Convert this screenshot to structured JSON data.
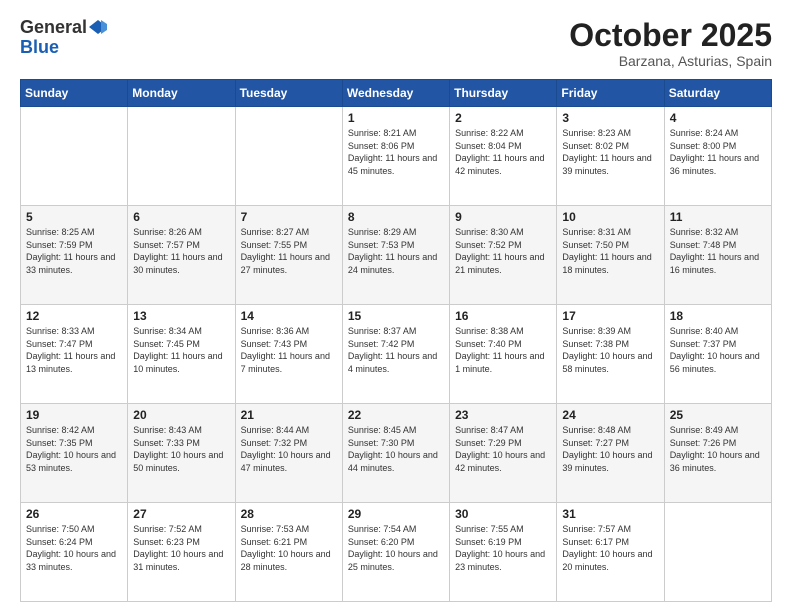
{
  "header": {
    "logo_general": "General",
    "logo_blue": "Blue",
    "month": "October 2025",
    "location": "Barzana, Asturias, Spain"
  },
  "weekdays": [
    "Sunday",
    "Monday",
    "Tuesday",
    "Wednesday",
    "Thursday",
    "Friday",
    "Saturday"
  ],
  "weeks": [
    [
      {
        "day": "",
        "sunrise": "",
        "sunset": "",
        "daylight": ""
      },
      {
        "day": "",
        "sunrise": "",
        "sunset": "",
        "daylight": ""
      },
      {
        "day": "",
        "sunrise": "",
        "sunset": "",
        "daylight": ""
      },
      {
        "day": "1",
        "sunrise": "8:21 AM",
        "sunset": "8:06 PM",
        "daylight": "11 hours and 45 minutes."
      },
      {
        "day": "2",
        "sunrise": "8:22 AM",
        "sunset": "8:04 PM",
        "daylight": "11 hours and 42 minutes."
      },
      {
        "day": "3",
        "sunrise": "8:23 AM",
        "sunset": "8:02 PM",
        "daylight": "11 hours and 39 minutes."
      },
      {
        "day": "4",
        "sunrise": "8:24 AM",
        "sunset": "8:00 PM",
        "daylight": "11 hours and 36 minutes."
      }
    ],
    [
      {
        "day": "5",
        "sunrise": "8:25 AM",
        "sunset": "7:59 PM",
        "daylight": "11 hours and 33 minutes."
      },
      {
        "day": "6",
        "sunrise": "8:26 AM",
        "sunset": "7:57 PM",
        "daylight": "11 hours and 30 minutes."
      },
      {
        "day": "7",
        "sunrise": "8:27 AM",
        "sunset": "7:55 PM",
        "daylight": "11 hours and 27 minutes."
      },
      {
        "day": "8",
        "sunrise": "8:29 AM",
        "sunset": "7:53 PM",
        "daylight": "11 hours and 24 minutes."
      },
      {
        "day": "9",
        "sunrise": "8:30 AM",
        "sunset": "7:52 PM",
        "daylight": "11 hours and 21 minutes."
      },
      {
        "day": "10",
        "sunrise": "8:31 AM",
        "sunset": "7:50 PM",
        "daylight": "11 hours and 18 minutes."
      },
      {
        "day": "11",
        "sunrise": "8:32 AM",
        "sunset": "7:48 PM",
        "daylight": "11 hours and 16 minutes."
      }
    ],
    [
      {
        "day": "12",
        "sunrise": "8:33 AM",
        "sunset": "7:47 PM",
        "daylight": "11 hours and 13 minutes."
      },
      {
        "day": "13",
        "sunrise": "8:34 AM",
        "sunset": "7:45 PM",
        "daylight": "11 hours and 10 minutes."
      },
      {
        "day": "14",
        "sunrise": "8:36 AM",
        "sunset": "7:43 PM",
        "daylight": "11 hours and 7 minutes."
      },
      {
        "day": "15",
        "sunrise": "8:37 AM",
        "sunset": "7:42 PM",
        "daylight": "11 hours and 4 minutes."
      },
      {
        "day": "16",
        "sunrise": "8:38 AM",
        "sunset": "7:40 PM",
        "daylight": "11 hours and 1 minute."
      },
      {
        "day": "17",
        "sunrise": "8:39 AM",
        "sunset": "7:38 PM",
        "daylight": "10 hours and 58 minutes."
      },
      {
        "day": "18",
        "sunrise": "8:40 AM",
        "sunset": "7:37 PM",
        "daylight": "10 hours and 56 minutes."
      }
    ],
    [
      {
        "day": "19",
        "sunrise": "8:42 AM",
        "sunset": "7:35 PM",
        "daylight": "10 hours and 53 minutes."
      },
      {
        "day": "20",
        "sunrise": "8:43 AM",
        "sunset": "7:33 PM",
        "daylight": "10 hours and 50 minutes."
      },
      {
        "day": "21",
        "sunrise": "8:44 AM",
        "sunset": "7:32 PM",
        "daylight": "10 hours and 47 minutes."
      },
      {
        "day": "22",
        "sunrise": "8:45 AM",
        "sunset": "7:30 PM",
        "daylight": "10 hours and 44 minutes."
      },
      {
        "day": "23",
        "sunrise": "8:47 AM",
        "sunset": "7:29 PM",
        "daylight": "10 hours and 42 minutes."
      },
      {
        "day": "24",
        "sunrise": "8:48 AM",
        "sunset": "7:27 PM",
        "daylight": "10 hours and 39 minutes."
      },
      {
        "day": "25",
        "sunrise": "8:49 AM",
        "sunset": "7:26 PM",
        "daylight": "10 hours and 36 minutes."
      }
    ],
    [
      {
        "day": "26",
        "sunrise": "7:50 AM",
        "sunset": "6:24 PM",
        "daylight": "10 hours and 33 minutes."
      },
      {
        "day": "27",
        "sunrise": "7:52 AM",
        "sunset": "6:23 PM",
        "daylight": "10 hours and 31 minutes."
      },
      {
        "day": "28",
        "sunrise": "7:53 AM",
        "sunset": "6:21 PM",
        "daylight": "10 hours and 28 minutes."
      },
      {
        "day": "29",
        "sunrise": "7:54 AM",
        "sunset": "6:20 PM",
        "daylight": "10 hours and 25 minutes."
      },
      {
        "day": "30",
        "sunrise": "7:55 AM",
        "sunset": "6:19 PM",
        "daylight": "10 hours and 23 minutes."
      },
      {
        "day": "31",
        "sunrise": "7:57 AM",
        "sunset": "6:17 PM",
        "daylight": "10 hours and 20 minutes."
      },
      {
        "day": "",
        "sunrise": "",
        "sunset": "",
        "daylight": ""
      }
    ]
  ]
}
